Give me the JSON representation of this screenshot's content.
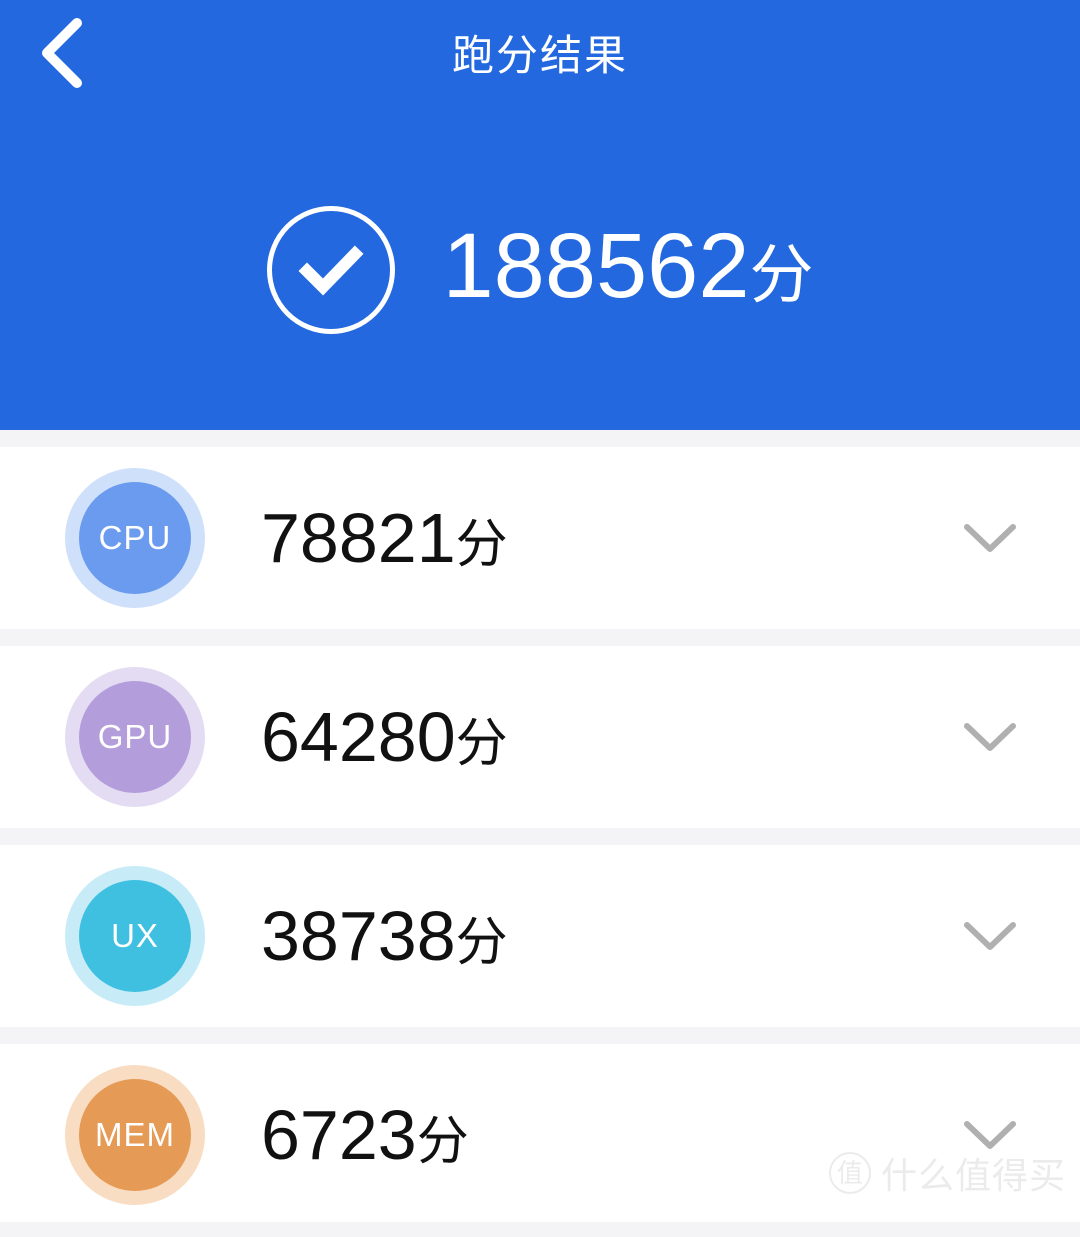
{
  "header": {
    "background_color": "#2468e0",
    "back_icon": "chevron-left-icon",
    "title": "跑分结果",
    "status_icon": "check-circle-icon",
    "total_score": "188562",
    "score_unit": "分"
  },
  "rows": [
    {
      "key": "cpu",
      "badge_label": "CPU",
      "badge_color": "#6a9bee",
      "badge_halo_color": "#cfe0fb",
      "score": "78821",
      "unit": "分",
      "expand_icon": "chevron-down-icon"
    },
    {
      "key": "gpu",
      "badge_label": "GPU",
      "badge_color": "#b49ddb",
      "badge_halo_color": "#e4dcf3",
      "score": "64280",
      "unit": "分",
      "expand_icon": "chevron-down-icon"
    },
    {
      "key": "ux",
      "badge_label": "UX",
      "badge_color": "#3fc0e0",
      "badge_halo_color": "#c7ecf7",
      "score": "38738",
      "unit": "分",
      "expand_icon": "chevron-down-icon"
    },
    {
      "key": "mem",
      "badge_label": "MEM",
      "badge_color": "#e59a55",
      "badge_halo_color": "#f8ddc2",
      "score": "6723",
      "unit": "分",
      "expand_icon": "chevron-down-icon"
    }
  ],
  "watermark": {
    "logo_text": "值",
    "text": "什么值得买"
  }
}
